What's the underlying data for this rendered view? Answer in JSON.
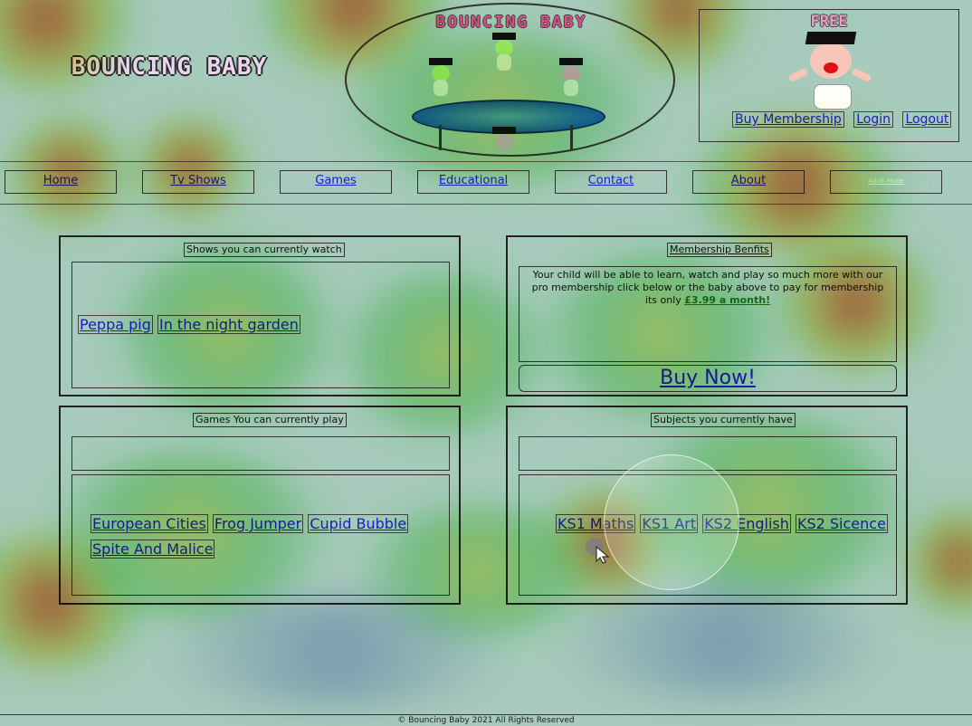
{
  "header": {
    "logo_text": "BOUNCING BABY",
    "ellipse_title": "BOUNCING BABY",
    "free_title": "FREE",
    "buy_membership": "Buy Membership",
    "login": "Login",
    "logout": "Logout"
  },
  "nav": {
    "items": [
      "Home",
      "Tv Shows",
      "Games",
      "Educational",
      "Contact",
      "About",
      "Adult Mode"
    ]
  },
  "shows": {
    "title": "Shows you can currently watch",
    "links": [
      "Peppa pig",
      "In the night garden"
    ]
  },
  "membership": {
    "title": "Membership Benfits",
    "text": "Your child will be able to learn, watch and play so much more with our pro membership click below or the baby above to pay for membership its only ",
    "price": "£3.99 a month!",
    "buy_now": "Buy Now!"
  },
  "games": {
    "title": "Games You can currently play",
    "links": [
      "European Cities",
      "Frog Jumper",
      "Cupid Bubble",
      "Spite And Malice"
    ]
  },
  "subjects": {
    "title": "Subjects you currently have",
    "links": [
      "KS1 Maths",
      "KS1 Art",
      "KS2 English",
      "KS2 Sicence"
    ]
  },
  "footer": {
    "text": "© Bouncing Baby 2021 All Rights Reserved"
  },
  "colors": {
    "background": "#a6cabb",
    "link": "#1c1ccb",
    "heat_hot": "#e83c28",
    "heat_warm": "#e6e63c"
  }
}
